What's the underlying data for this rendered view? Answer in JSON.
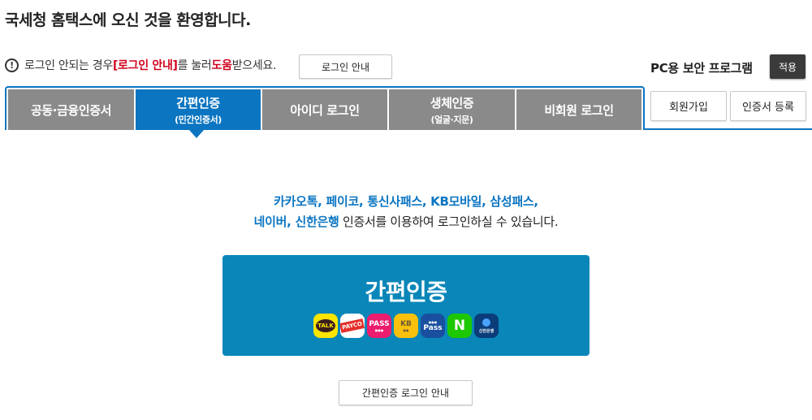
{
  "header": {
    "welcome": "국세청 홈택스에 오신 것을 환영합니다."
  },
  "notice": {
    "prefix": "로그인 안되는 경우 ",
    "highlight1": "[로그인 안내]",
    "middle": "를 눌러 ",
    "highlight2": "도움",
    "suffix": "받으세요.",
    "guide_button": "로그인 안내"
  },
  "security": {
    "label": "PC용 보안 프로그램",
    "apply_button": "적용"
  },
  "tabs": [
    {
      "label": "공동·금융인증서",
      "sub": ""
    },
    {
      "label": "간편인증",
      "sub": "(민간인증서)"
    },
    {
      "label": "아이디 로그인",
      "sub": ""
    },
    {
      "label": "생체인증",
      "sub": "(얼굴·지문)"
    },
    {
      "label": "비회원 로그인",
      "sub": ""
    }
  ],
  "side_buttons": {
    "join": "회원가입",
    "register_cert": "인증서 등록"
  },
  "promo": {
    "line1_blue": "카카오톡, 페이코, 통신사패스, KB모바일, 삼성패스,",
    "line2_blue": "네이버, 신한은행",
    "line2_rest": " 인증서를 이용하여 로그인하실 수 있습니다."
  },
  "easy_auth": {
    "title": "간편인증",
    "icons": {
      "kakao": "TALK",
      "payco": "PAYCO",
      "pass": "PASS",
      "kb": "KB",
      "samsung_pass": "Pass",
      "naver": "N",
      "shinhan": "신한은행"
    }
  },
  "easy_guide_button": "간편인증 로그인 안내",
  "colors": {
    "accent": "#0b75c1",
    "tab_inactive": "#8a8a8a",
    "big_button": "#0a86b8",
    "highlight_red": "#d0021b"
  }
}
